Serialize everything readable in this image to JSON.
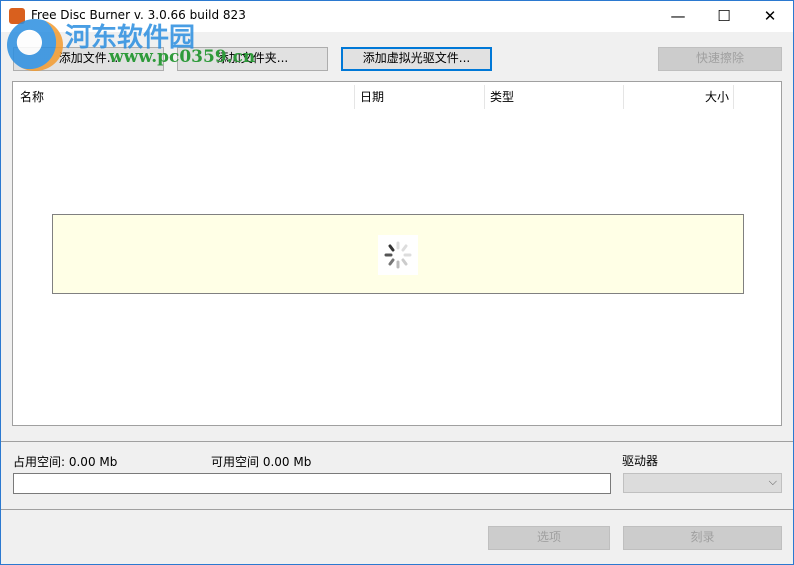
{
  "window": {
    "title": "Free Disc Burner   v. 3.0.66 build 823",
    "minimize": "—",
    "maximize": "☐",
    "close": "✕"
  },
  "watermark": {
    "name": "河东软件园",
    "url": "www.pc0359.cn"
  },
  "toolbar": {
    "add_files": "添加文件...",
    "add_folder": "添加文件夹...",
    "add_virtual": "添加虚拟光驱文件...",
    "quick_erase": "快速擦除"
  },
  "list": {
    "columns": [
      "名称",
      "日期",
      "类型",
      "大小"
    ]
  },
  "status": {
    "used_label": "占用空间: 0.00 Mb",
    "free_label": "可用空间 0.00 Mb",
    "drive_label": "驱动器",
    "drive_value": ""
  },
  "footer": {
    "options": "选项",
    "burn": "刻录"
  }
}
